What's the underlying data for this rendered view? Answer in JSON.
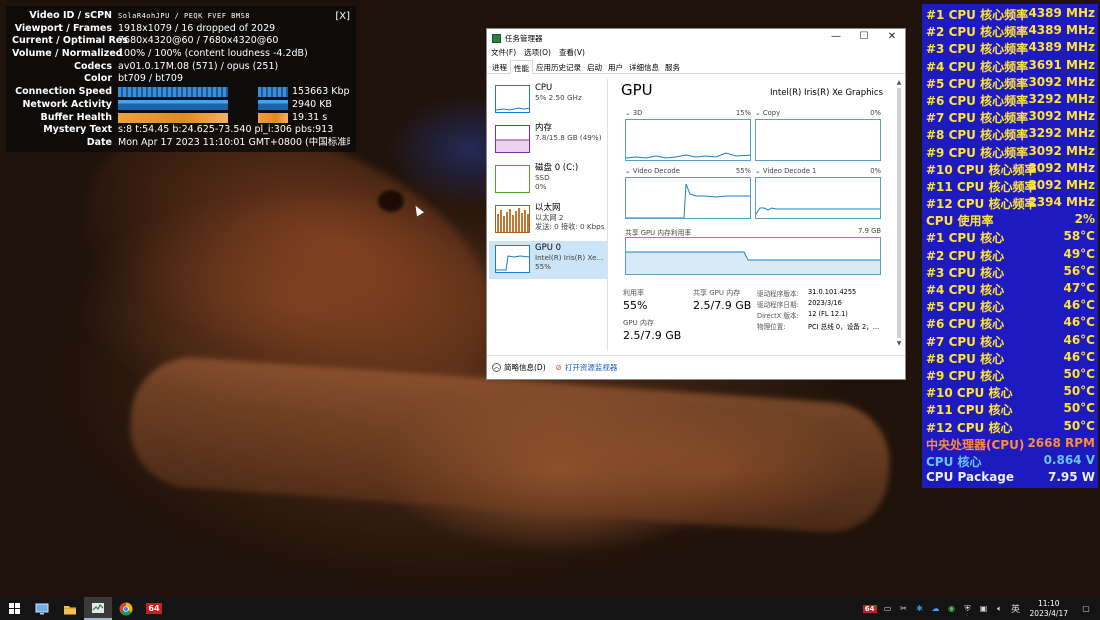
{
  "stats": {
    "close_label": "[X]",
    "rows": [
      {
        "label": "Video ID / sCPN",
        "value": "SolaR4ohJPU / PEQK FVEF BMS8"
      },
      {
        "label": "Viewport / Frames",
        "value": "1918x1079 / 16 dropped of 2029"
      },
      {
        "label": "Current / Optimal Res",
        "value": "7680x4320@60 / 7680x4320@60"
      },
      {
        "label": "Volume / Normalized",
        "value": "100% / 100% (content loudness -4.2dB)"
      },
      {
        "label": "Codecs",
        "value": "av01.0.17M.08 (571) / opus (251)"
      },
      {
        "label": "Color",
        "value": "bt709 / bt709"
      },
      {
        "label": "Connection Speed",
        "value": "153663 Kbps"
      },
      {
        "label": "Network Activity",
        "value": "2940 KB"
      },
      {
        "label": "Buffer Health",
        "value": "19.31 s"
      },
      {
        "label": "Mystery Text",
        "value": "s:8 t:54.45 b:24.625-73.540 pl_i:306 pbs:913"
      },
      {
        "label": "Date",
        "value": "Mon Apr 17 2023 11:10:01 GMT+0800 (中国标准时间)"
      }
    ]
  },
  "taskmgr": {
    "title": "任务管理器",
    "win_buttons": {
      "minimize": "—",
      "maximize": "☐",
      "close": "✕"
    },
    "menu": [
      "文件(F)",
      "选项(O)",
      "查看(V)"
    ],
    "tabs": [
      "进程",
      "性能",
      "应用历史记录",
      "启动",
      "用户",
      "详细信息",
      "服务"
    ],
    "active_tab": "性能",
    "resources": [
      {
        "title": "CPU",
        "sub1": "5% 2.50 GHz",
        "sub2": "",
        "color": "#1a7fc7"
      },
      {
        "title": "内存",
        "sub1": "7.8/15.8 GB (49%)",
        "sub2": "",
        "color": "#8b2a9b"
      },
      {
        "title": "磁盘 0 (C:)",
        "sub1": "SSD",
        "sub2": "0%",
        "color": "#4ca82c"
      },
      {
        "title": "以太网",
        "sub1": "以太网 2",
        "sub2": "发送: 0 接收: 0 Kbps",
        "color": "#a7601e"
      },
      {
        "title": "GPU 0",
        "sub1": "Intel(R) Iris(R) Xe...",
        "sub2": "55%",
        "color": "#1a7fc7"
      }
    ],
    "gpu": {
      "title": "GPU",
      "model": "Intel(R) Iris(R) Xe Graphics",
      "engines": [
        {
          "name": "3D",
          "percent": "15%"
        },
        {
          "name": "Copy",
          "percent": "0%"
        },
        {
          "name": "Video Decode",
          "percent": "55%"
        },
        {
          "name": "Video Decode 1",
          "percent": "0%"
        }
      ],
      "shared_mem_label": "共享 GPU 内存利用率",
      "shared_mem_max": "7.9 GB",
      "utilization_label": "利用率",
      "utilization_value": "55%",
      "shared_gpu_mem_label": "共享 GPU 内存",
      "shared_gpu_mem_value": "2.5/7.9 GB",
      "gpu_mem_label": "GPU 内存",
      "gpu_mem_value": "2.5/7.9 GB",
      "details": [
        {
          "key": "驱动程序版本:",
          "value": "31.0.101.4255"
        },
        {
          "key": "驱动程序日期:",
          "value": "2023/3/16"
        },
        {
          "key": "DirectX 版本:",
          "value": "12 (FL 12.1)"
        },
        {
          "key": "物理位置:",
          "value": "PCI 总线 0，设备 2，..."
        }
      ]
    },
    "footer": {
      "brief": "简略信息(D)",
      "resmon": "打开资源监视器"
    }
  },
  "osd": {
    "rows": [
      {
        "key": "#1 CPU 核心频率",
        "value": "4389 MHz",
        "color": "yellow"
      },
      {
        "key": "#2 CPU 核心频率",
        "value": "4389 MHz",
        "color": "yellow"
      },
      {
        "key": "#3 CPU 核心频率",
        "value": "4389 MHz",
        "color": "yellow"
      },
      {
        "key": "#4 CPU 核心频率",
        "value": "3691 MHz",
        "color": "yellow"
      },
      {
        "key": "#5 CPU 核心频率",
        "value": "3092 MHz",
        "color": "yellow"
      },
      {
        "key": "#6 CPU 核心频率",
        "value": "3292 MHz",
        "color": "yellow"
      },
      {
        "key": "#7 CPU 核心频率",
        "value": "3092 MHz",
        "color": "yellow"
      },
      {
        "key": "#8 CPU 核心频率",
        "value": "3292 MHz",
        "color": "yellow"
      },
      {
        "key": "#9 CPU 核心频率",
        "value": "3092 MHz",
        "color": "yellow"
      },
      {
        "key": "#10 CPU 核心频率",
        "value": "3092 MHz",
        "color": "yellow"
      },
      {
        "key": "#11 CPU 核心频率",
        "value": "3092 MHz",
        "color": "yellow"
      },
      {
        "key": "#12 CPU 核心频率",
        "value": "2394 MHz",
        "color": "yellow"
      },
      {
        "key": "CPU 使用率",
        "value": "2%",
        "color": "yellow"
      },
      {
        "key": " #1 CPU 核心",
        "value": "58°C",
        "color": "yellow"
      },
      {
        "key": " #2 CPU 核心",
        "value": "49°C",
        "color": "yellow"
      },
      {
        "key": " #3 CPU 核心",
        "value": "56°C",
        "color": "yellow"
      },
      {
        "key": " #4 CPU 核心",
        "value": "47°C",
        "color": "yellow"
      },
      {
        "key": " #5 CPU 核心",
        "value": "46°C",
        "color": "yellow"
      },
      {
        "key": " #6 CPU 核心",
        "value": "46°C",
        "color": "yellow"
      },
      {
        "key": " #7 CPU 核心",
        "value": "46°C",
        "color": "yellow"
      },
      {
        "key": " #8 CPU 核心",
        "value": "46°C",
        "color": "yellow"
      },
      {
        "key": " #9 CPU 核心",
        "value": "50°C",
        "color": "yellow"
      },
      {
        "key": " #10 CPU 核心",
        "value": "50°C",
        "color": "yellow"
      },
      {
        "key": " #11 CPU 核心",
        "value": "50°C",
        "color": "yellow"
      },
      {
        "key": " #12 CPU 核心",
        "value": "50°C",
        "color": "yellow"
      },
      {
        "key": "中央处理器(CPU)",
        "value": "2668 RPM",
        "color": "orange"
      },
      {
        "key": "CPU 核心",
        "value": "0.864 V",
        "color": "sky"
      },
      {
        "key": "CPU Package",
        "value": "7.95 W",
        "color": "light"
      }
    ]
  },
  "taskbar": {
    "apps": [
      {
        "name": "start",
        "icon": "windows-logo-icon",
        "label": ""
      },
      {
        "name": "desktop-app",
        "icon": "monitor-icon",
        "label": ""
      },
      {
        "name": "file-explorer",
        "icon": "folder-icon",
        "label": ""
      },
      {
        "name": "task-manager",
        "icon": "task-manager-icon",
        "label": ""
      },
      {
        "name": "chrome",
        "icon": "chrome-icon",
        "label": ""
      },
      {
        "name": "aida64",
        "icon": "aida64-icon",
        "label": "64"
      }
    ],
    "tray_badge": "64",
    "ime": "英",
    "time": "11:10",
    "date": "2023/4/17"
  }
}
